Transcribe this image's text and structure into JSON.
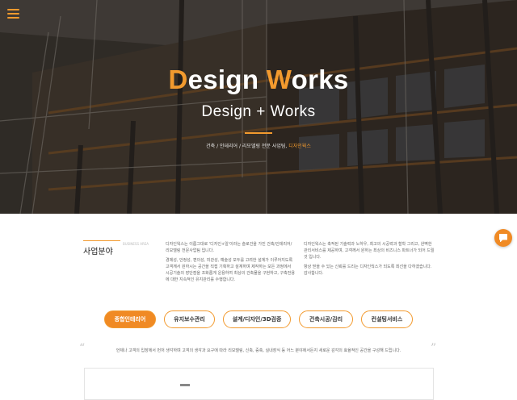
{
  "hero": {
    "title_accent_1": "D",
    "title_part_1": "esign ",
    "title_accent_2": "W",
    "title_part_2": "orks",
    "subtitle": "Design + Works",
    "breadcrumb_path": "건축 / 인테리어 / 리모델링 전문 사업팀,",
    "breadcrumb_current": "디자인웍스"
  },
  "section": {
    "title": "사업분야",
    "title_en": "BUSINESS AREA"
  },
  "intro_left": {
    "p1": "디자인웍스는 이름그대로 '디자인+일'이라는 슬로건을 가진 건축/인테리어/리모델링 전문사업팀 입니다.",
    "p2": "경제성, 안정성, 편의성, 미관성, 예술성 모두를 고려한 설계가 이루어지도록 고객께서 원하시는 공간을 직접 기획하고 설계하며 제작하는 모든 과정에서 시공기술의 장단점을 조화롭게 운용하여 최상의 건축물을 구현하고, 구축전용에 대한 지속적인 유지관리를 수행합니다."
  },
  "intro_right": {
    "p1": "디자인웍스는 축적된 기술력과 노하우, 최고의 시공력과 철학 그리고, 완벽한 관리서비스를 제공하며, 고객께서 원하는 최상의 비즈니스 파트너가 되어 드릴 것 입니다.",
    "p2": "항상 믿을 수 있는 신뢰를 드리는 디자인웍스가 되도록 최선을 다하겠습니다. 감사합니다."
  },
  "tabs": [
    {
      "label": "종합인테리어"
    },
    {
      "label": "유지보수관리"
    },
    {
      "label": "설계/디자인/3D검증"
    },
    {
      "label": "건축시공/감리"
    },
    {
      "label": "컨설팅서비스"
    }
  ],
  "quote_open": "“",
  "quote_close": "”",
  "description": "언제나 고객의 입장에서 먼저 생각하며 고객의 생각과 요구에 따라 리모델링, 신축, 증축, 실내장식 등 어느 분야에서든지 새로운 감각의 효율적인 공간을 구성해 드립니다.",
  "colors": {
    "accent": "#f29a2e",
    "active_tab": "#f08a24"
  },
  "icons": {
    "menu": "hamburger-menu-icon",
    "chat": "chat-bubble-icon"
  }
}
